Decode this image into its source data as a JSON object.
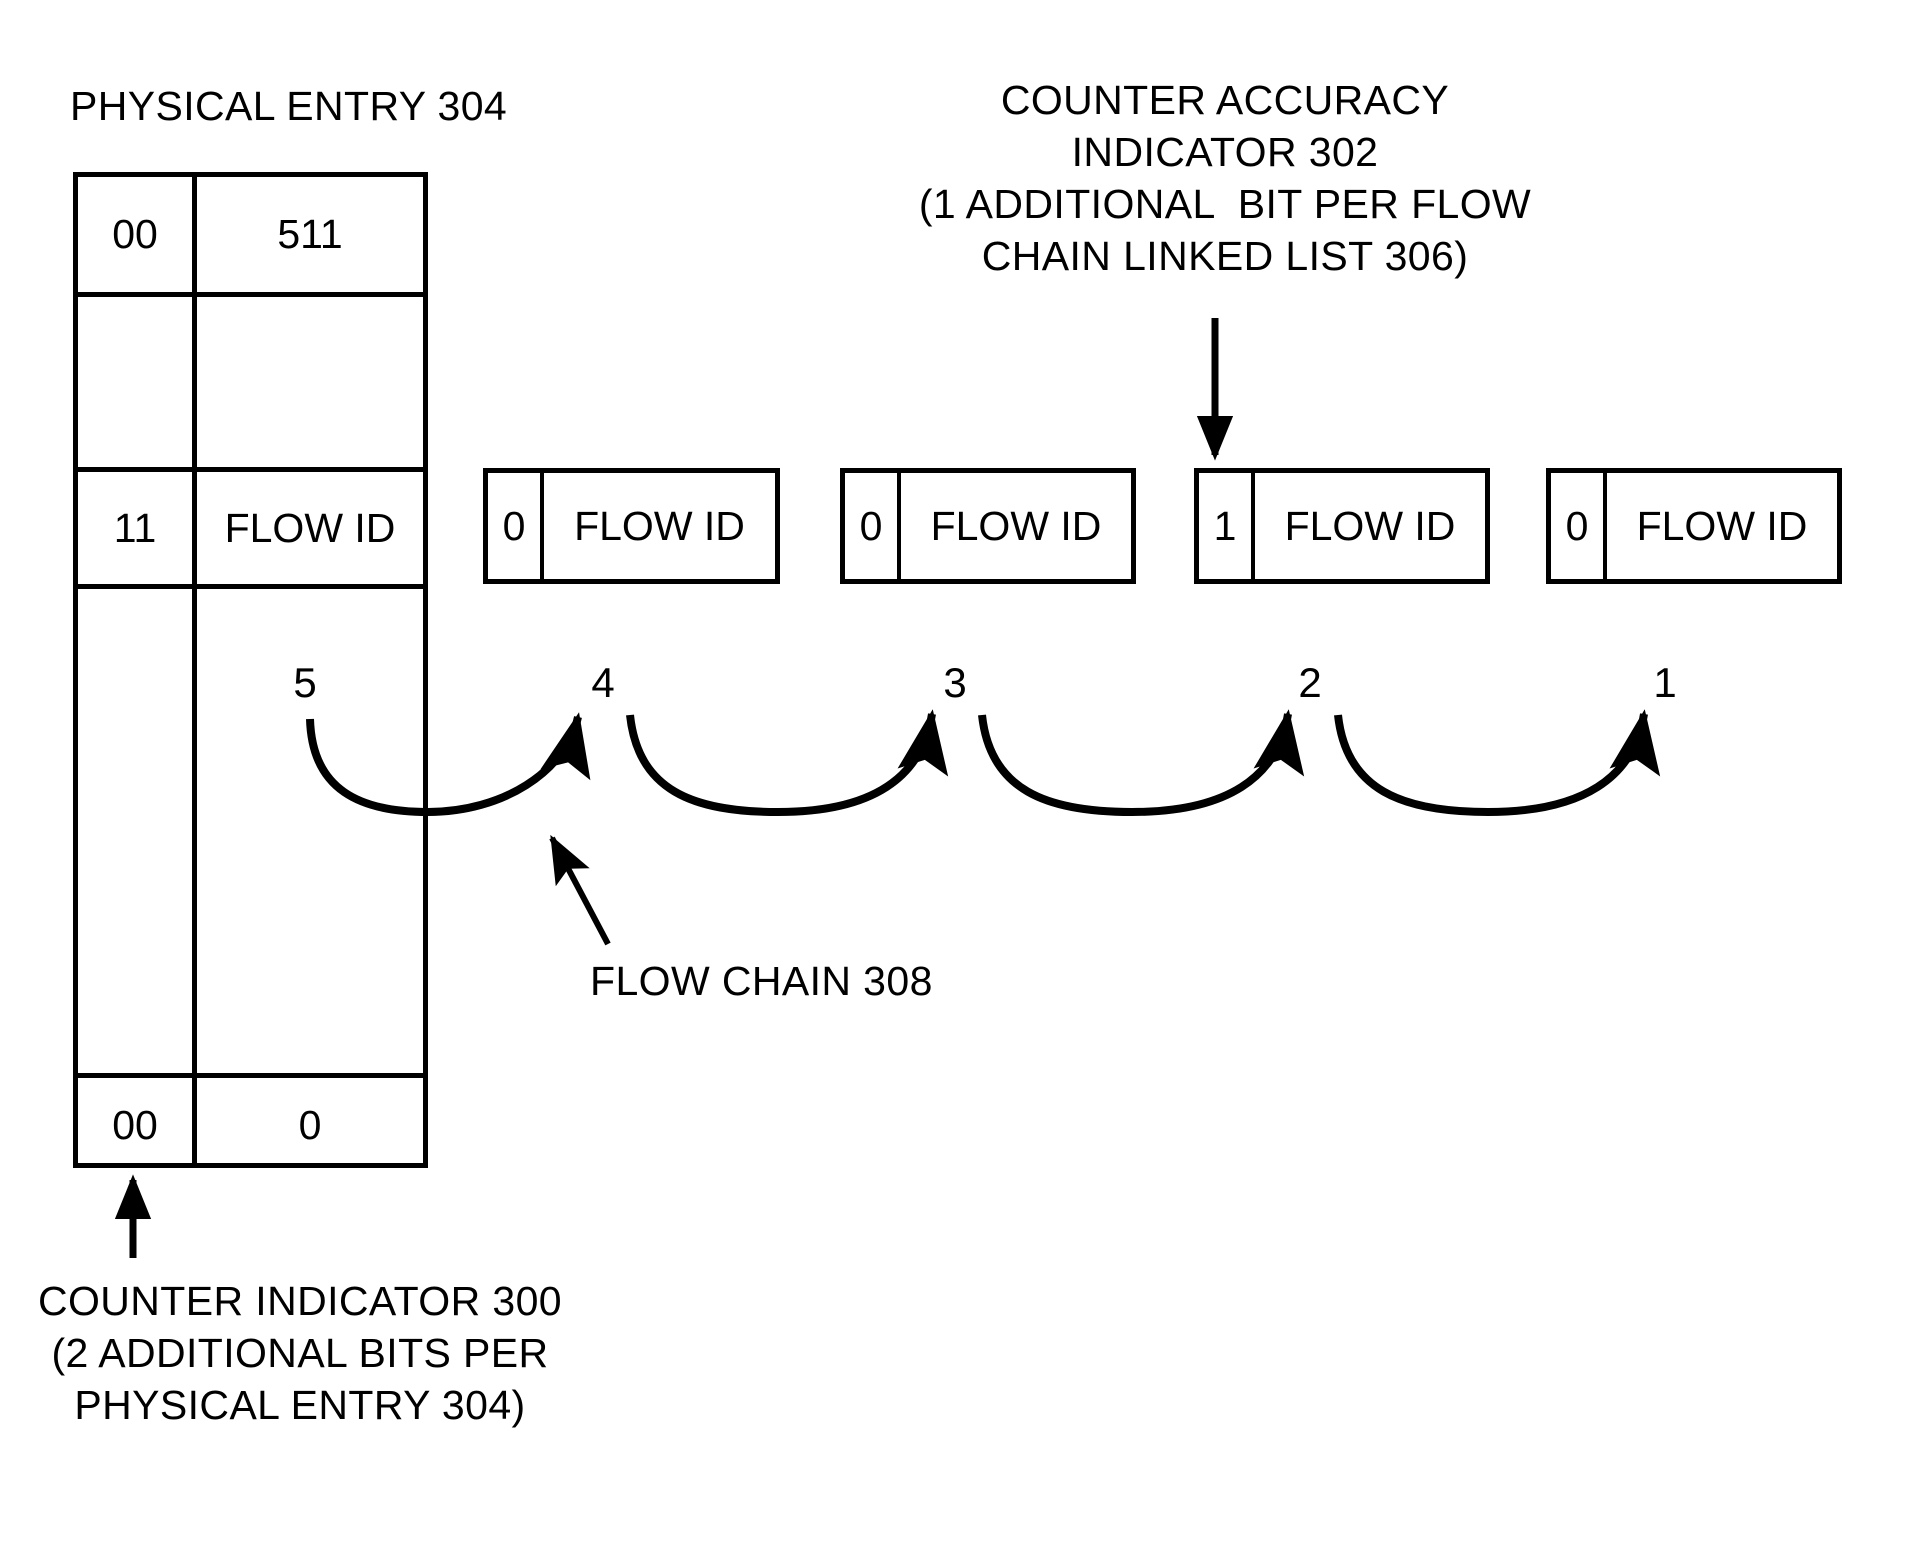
{
  "labels": {
    "physical_entry_title": "PHYSICAL ENTRY 304",
    "counter_accuracy": {
      "line1": "COUNTER ACCURACY",
      "line2": "INDICATOR 302",
      "line3": "(1 ADDITIONAL  BIT PER FLOW",
      "line4": "CHAIN LINKED LIST 306)"
    },
    "flow_chain": "FLOW CHAIN 308",
    "counter_indicator": {
      "line1": "COUNTER INDICATOR 300",
      "line2": "(2 ADDITIONAL BITS PER",
      "line3": "PHYSICAL ENTRY 304)"
    }
  },
  "physical_entry_table": {
    "rows": [
      {
        "counter_bits": "00",
        "value": "511"
      },
      {
        "counter_bits": "",
        "value": ""
      },
      {
        "counter_bits": "11",
        "value": "FLOW ID"
      },
      {
        "counter_bits": "",
        "value": ""
      },
      {
        "counter_bits": "00",
        "value": "0"
      }
    ]
  },
  "flow_chain_linked_list": {
    "nodes": [
      {
        "accuracy_bit": "0",
        "label": "FLOW ID"
      },
      {
        "accuracy_bit": "0",
        "label": "FLOW ID"
      },
      {
        "accuracy_bit": "1",
        "label": "FLOW ID"
      },
      {
        "accuracy_bit": "0",
        "label": "FLOW ID"
      }
    ]
  },
  "chain_positions": {
    "n5": "5",
    "n4": "4",
    "n3": "3",
    "n2": "2",
    "n1": "1"
  },
  "colors": {
    "ink": "#000000",
    "paper": "#ffffff"
  }
}
